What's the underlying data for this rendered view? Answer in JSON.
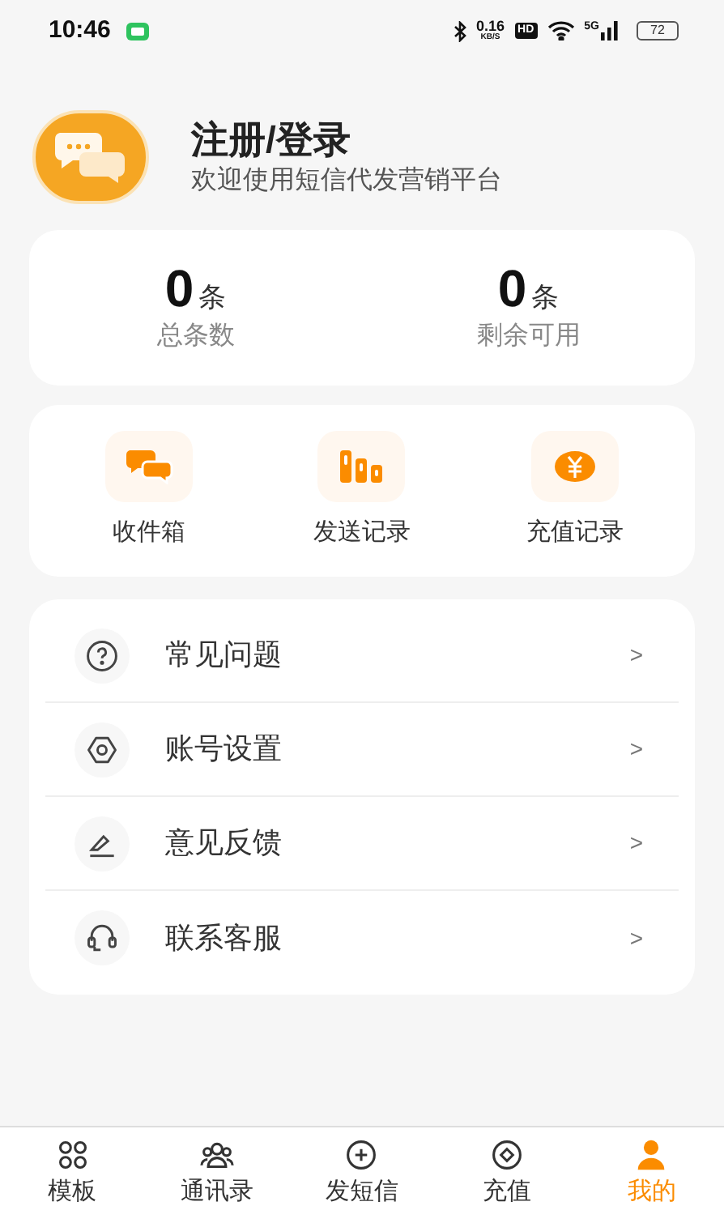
{
  "status_bar": {
    "time": "10:46",
    "speed": "0.16",
    "speed_unit": "KB/S",
    "hd": "HD",
    "network": "5G",
    "battery": "72"
  },
  "profile": {
    "title": "注册/登录",
    "subtitle": "欢迎使用短信代发营销平台"
  },
  "stats": [
    {
      "value": "0",
      "unit": "条",
      "label": "总条数"
    },
    {
      "value": "0",
      "unit": "条",
      "label": "剩余可用"
    }
  ],
  "shortcuts": [
    {
      "label": "收件箱"
    },
    {
      "label": "发送记录"
    },
    {
      "label": "充值记录"
    }
  ],
  "menu": [
    {
      "label": "常见问题",
      "arrow": ">"
    },
    {
      "label": "账号设置",
      "arrow": ">"
    },
    {
      "label": "意见反馈",
      "arrow": ">"
    },
    {
      "label": "联系客服",
      "arrow": ">"
    }
  ],
  "tabs": [
    {
      "label": "模板",
      "selected": false
    },
    {
      "label": "通讯录",
      "selected": false
    },
    {
      "label": "发短信",
      "selected": false
    },
    {
      "label": "充值",
      "selected": false
    },
    {
      "label": "我的",
      "selected": true
    }
  ]
}
